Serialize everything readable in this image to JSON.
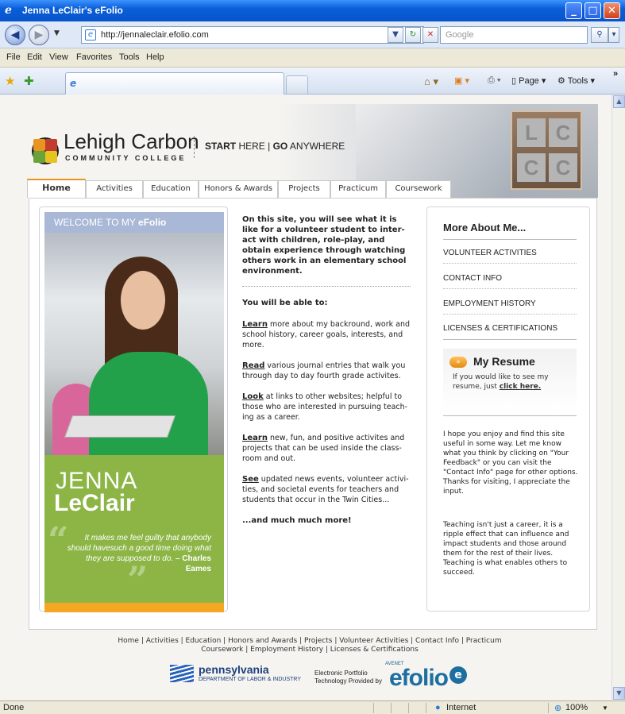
{
  "window": {
    "title": "Jenna LeClair's eFolio",
    "minimize": "_",
    "maximize": "□",
    "close": "✕"
  },
  "address_bar": {
    "url": "http://jennaleclair.efolio.com",
    "search_placeholder": "Google"
  },
  "menu": [
    "File",
    "Edit",
    "View",
    "Favorites",
    "Tools",
    "Help"
  ],
  "toolbar": {
    "page_label": "Page",
    "tools_label": "Tools",
    "chevron": "»"
  },
  "site": {
    "logo_name": "Lehigh Carbon",
    "logo_sub": "COMMUNITY COLLEGE",
    "tagline_start": "START",
    "tagline_here": " HERE | ",
    "tagline_go": "GO",
    "tagline_anywhere": " ANYWHERE",
    "lcc_letters": [
      "L",
      "C",
      "C",
      "C"
    ]
  },
  "nav_tabs": [
    "Home",
    "Activities",
    "Education",
    "Honors & Awards",
    "Projects",
    "Practicum",
    "Coursework"
  ],
  "left": {
    "welcome_prefix": "WELCOME TO MY ",
    "welcome_brand": "eFolio",
    "first_name": "JENNA",
    "last_name": "LeClair",
    "quote": "It makes me feel guilty that anybody should havesuch a good time doing what they are supposed to do.",
    "quote_author": " – Charles Eames"
  },
  "middle": {
    "intro": "On this site, you will see what it is like for a volunteer student to inter-act with children, role-play, and obtain experience through watching others work in an elementary school environment.",
    "able_heading": "You will be able to:",
    "items": [
      {
        "verb": "Learn",
        "text": " more about my backround, work and school history, career goals, interests, and more."
      },
      {
        "verb": "Read",
        "text": " various journal entries that walk you through day to day fourth grade activites."
      },
      {
        "verb": "Look",
        "text": " at links to other websites; helpful to those who are interested in pursuing teach-ing as a career."
      },
      {
        "verb": "Learn",
        "text": " new, fun, and positive activites and projects that can be used inside the class-room and out."
      },
      {
        "verb": "See",
        "text": " updated news events, volunteer activi-ties, and societal events for teachers and students that occur in the Twin Cities..."
      }
    ],
    "more": "...and much much more!"
  },
  "right": {
    "title": "More About Me...",
    "links": [
      "VOLUNTEER ACTIVITIES",
      "CONTACT INFO",
      "EMPLOYMENT HISTORY",
      "LICENSES & CERTIFICATIONS"
    ],
    "resume_title": "My Resume",
    "resume_text": "If you would like to see my resume, just ",
    "resume_link": "click here.",
    "para1": "I hope you enjoy and find this site useful in some way. Let me know what you think by clicking on \"Your Feedback\" or you can visit the \"Contact Info\" page for other options. Thanks for visiting, I appreciate the input.",
    "para2": "Teaching isn't just a career, it is a ripple effect that can influence and impact students and those around them for the rest of their lives. Teaching is what enables others to succeed."
  },
  "footer": {
    "line1": "Home | Activities | Education | Honors and Awards | Projects | Volunteer Activities | Contact Info | Practicum",
    "line2": "Coursework | Employment History | Licenses & Certifications",
    "pa_name": "pennsylvania",
    "pa_sub": "DEPARTMENT OF LABOR & INDUSTRY",
    "ep_line1": "Electronic Portfolio",
    "ep_line2": "Technology Provided by",
    "avenet": "AVENET",
    "efolio": "efolio",
    "efolio_e": "e"
  },
  "status": {
    "left": "Done",
    "zone": "Internet",
    "zoom": "100%"
  }
}
